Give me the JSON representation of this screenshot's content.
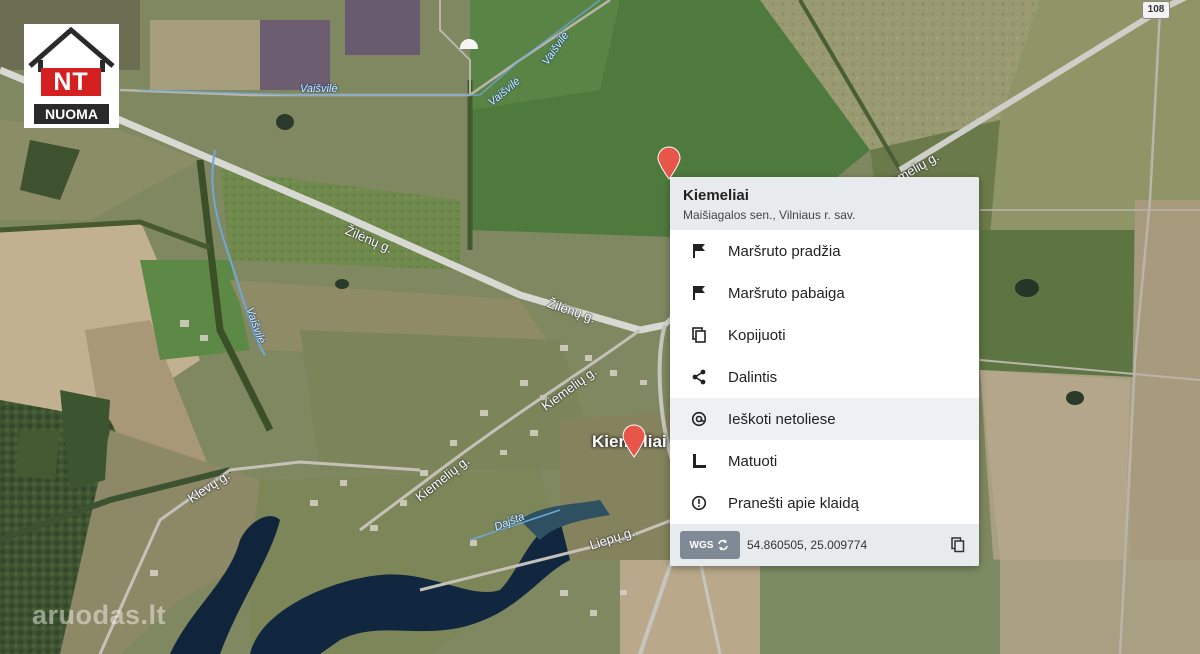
{
  "logo": {
    "top": "NT",
    "bottom": "NUOMA"
  },
  "road_shield": "108",
  "road_labels": {
    "vaisvile_1": "Vaišvilė",
    "vaisvile_2": "Vaišvilė",
    "vaisvile_3": "Vaišvilė",
    "zilenu_1": "Žilėnų g.",
    "zilenu_2": "Žilėnų g.",
    "kiemeliu_1": "Kiemelių g.",
    "kiemeliu_2": "Kiemelių g.",
    "kiemeliu_3": "Kiemelių g.",
    "klevu": "Klevų g.",
    "liepu": "Liepų g.",
    "dajsta": "Dajšta"
  },
  "place_label": "Kiemeliai",
  "popup": {
    "title": "Kiemeliai",
    "subtitle": "Maišiagalos sen., Vilniaus r. sav.",
    "items": [
      {
        "label": "Maršruto pradžia",
        "icon": "flag-icon"
      },
      {
        "label": "Maršruto pabaiga",
        "icon": "flag-icon"
      },
      {
        "label": "Kopijuoti",
        "icon": "copy-icon"
      },
      {
        "label": "Dalintis",
        "icon": "share-icon"
      },
      {
        "label": "Ieškoti netoliese",
        "icon": "at-search-icon"
      },
      {
        "label": "Matuoti",
        "icon": "ruler-icon"
      },
      {
        "label": "Pranešti apie klaidą",
        "icon": "error-icon"
      }
    ],
    "footer": {
      "wgs_label": "WGS",
      "coordinates": "54.860505, 25.009774"
    }
  },
  "watermark": "aruodas.lt",
  "colors": {
    "marker": "#e8564a",
    "popup_header": "#e8ebee",
    "wgs_button": "#7f8a96"
  }
}
